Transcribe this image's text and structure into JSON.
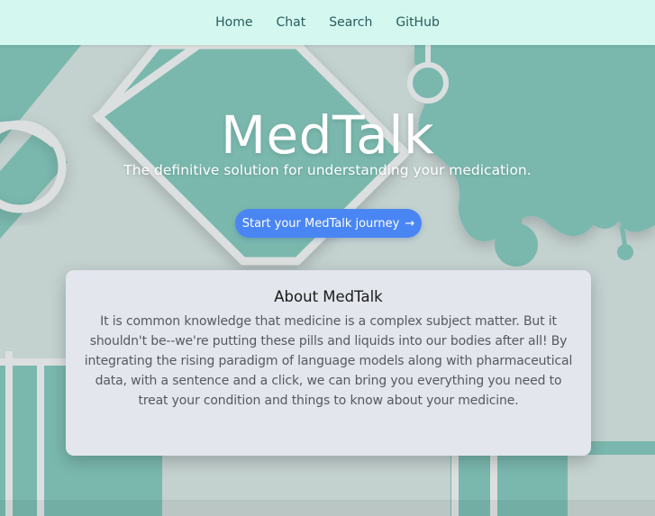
{
  "nav": {
    "items": [
      {
        "label": "Home"
      },
      {
        "label": "Chat"
      },
      {
        "label": "Search"
      },
      {
        "label": "GitHub"
      }
    ]
  },
  "hero": {
    "title": "MedTalk",
    "subtitle": "The definitive solution for understanding your medication.",
    "cta_label": "Start your MedTalk journey",
    "cta_arrow": "→"
  },
  "about": {
    "title": "About MedTalk",
    "body": "It is common knowledge that medicine is a complex subject matter. But it shouldn't be--we're putting these pills and liquids into our bodies after all! By integrating the rising paradigm of language models along with pharmaceutical data, with a sentence and a click, we can bring you everything you need to treat your condition and things to know about your medicine."
  },
  "colors": {
    "nav_bg": "#d4f8ef",
    "nav_text": "#2a5a5c",
    "accent": "#4a86f3",
    "teal": "#7ab8ae",
    "card_bg": "#e3e6ed"
  }
}
